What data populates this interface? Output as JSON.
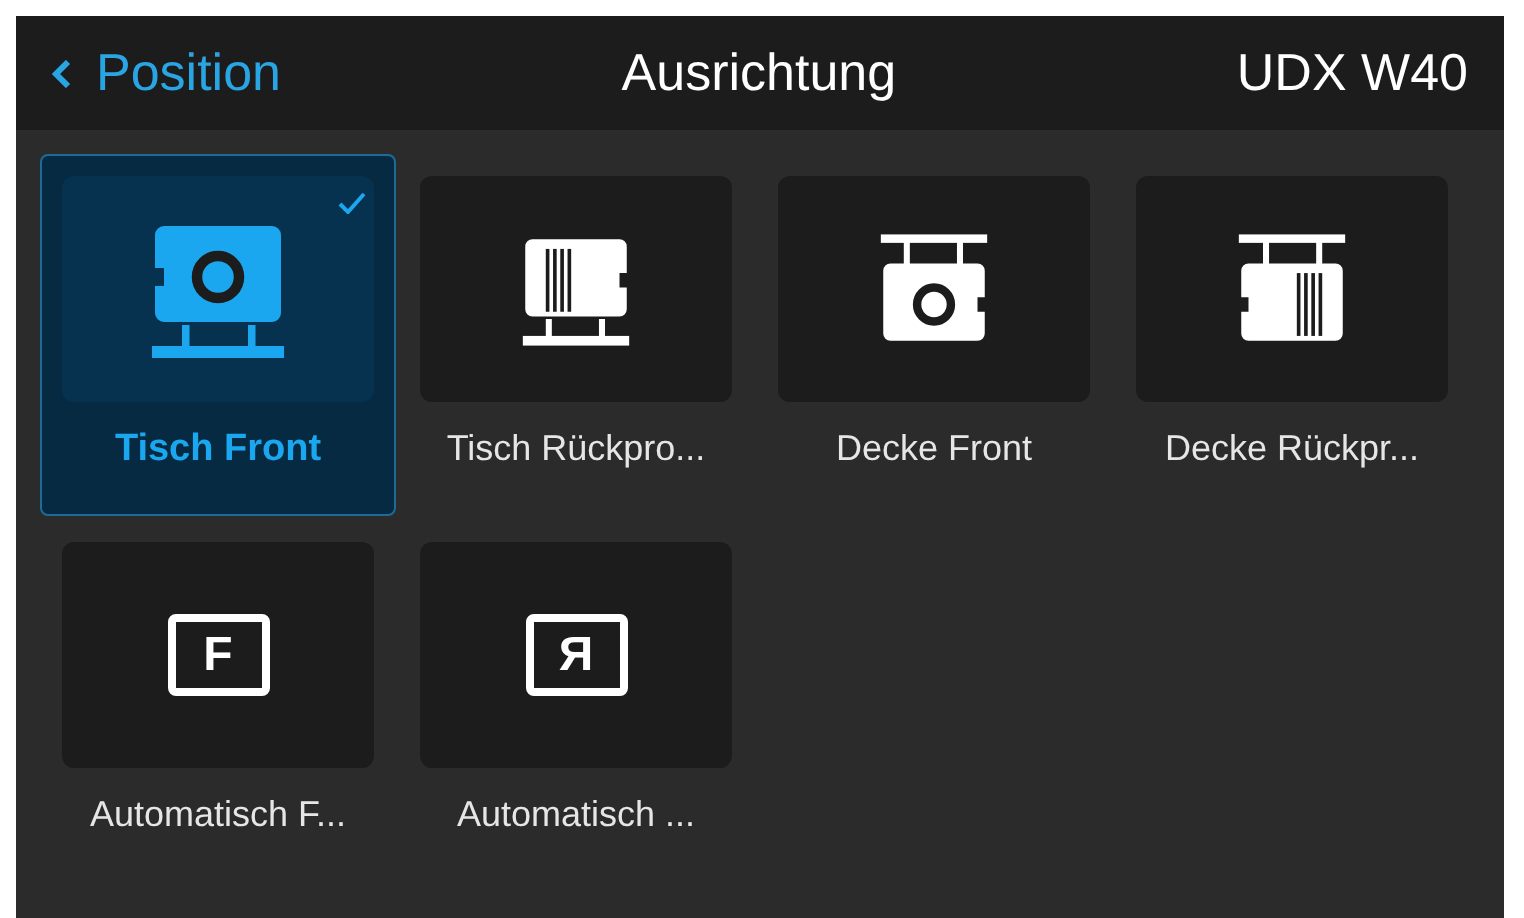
{
  "header": {
    "back_label": "Position",
    "title": "Ausrichtung",
    "device": "UDX W40"
  },
  "options": [
    {
      "label": "Tisch Front",
      "kind": "table-front",
      "selected": true
    },
    {
      "label": "Tisch Rückpro...",
      "kind": "table-rear",
      "selected": false
    },
    {
      "label": "Decke Front",
      "kind": "ceiling-front",
      "selected": false
    },
    {
      "label": "Decke Rückpr...",
      "kind": "ceiling-rear",
      "selected": false
    },
    {
      "label": "Automatisch F...",
      "kind": "letter",
      "glyph": "F",
      "selected": false
    },
    {
      "label": "Automatisch ...",
      "kind": "letter",
      "glyph": "Я",
      "selected": false
    }
  ]
}
